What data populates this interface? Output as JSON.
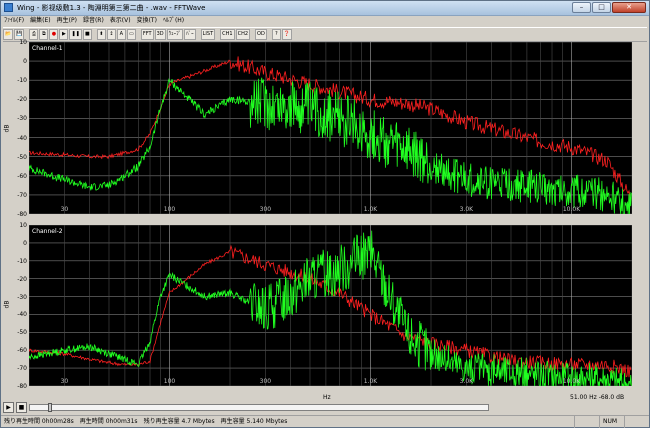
{
  "window": {
    "title": "Wing - 影视级敷1.3 - 陶淵明第三第二曲 - .wav - FFTWave",
    "min_label": "–",
    "max_label": "□",
    "close_label": "✕"
  },
  "menu": [
    "ﾌｧｲﾙ(F)",
    "編集(E)",
    "再生(P)",
    "録音(R)",
    "表示(V)",
    "変換(T)",
    "ﾍﾙﾌﾟ(H)"
  ],
  "toolbar": {
    "buttons": [
      "open",
      "save",
      "",
      "print",
      "copy",
      "rec",
      "play",
      "pause",
      "stop",
      "",
      "cursor",
      "zoom",
      "text",
      "view",
      "",
      "FFT",
      "3D",
      "Wave",
      "Bars",
      "",
      "LIST",
      "",
      "CH1",
      "CH2",
      "",
      "OD",
      "",
      "?",
      "help"
    ],
    "labels": {
      "FFT": "FFT",
      "3D": "3D",
      "Wave": "ｳｪｰﾌﾞ",
      "Bars": "ﾊﾞｰ",
      "LIST": "LIST",
      "CH1": "CH1",
      "CH2": "CH2",
      "OD": "OD",
      "rec": "●",
      "play": "▶",
      "pause": "❚❚",
      "stop": "■",
      "cursor": "⬍",
      "zoom": "↕",
      "text": "A",
      "view": "▭",
      "open": "📂",
      "save": "💾",
      "print": "⎙",
      "copy": "⧉",
      "?": "?",
      "help": "❓"
    }
  },
  "charts": [
    {
      "channel_label": "Channel-1",
      "y_ticks": [
        "10",
        "0",
        "-10",
        "-20",
        "-30",
        "-40",
        "-50",
        "-60",
        "-70",
        "-80"
      ],
      "x_ticks": [
        "30",
        "100",
        "300",
        "1.0K",
        "3.0K",
        "10.0K"
      ],
      "ylabel": "dB"
    },
    {
      "channel_label": "Channel-2",
      "y_ticks": [
        "10",
        "0",
        "-10",
        "-20",
        "-30",
        "-40",
        "-50",
        "-60",
        "-70",
        "-80"
      ],
      "x_ticks": [
        "30",
        "100",
        "300",
        "1.0K",
        "3.0K",
        "10.0K"
      ],
      "ylabel": "dB"
    }
  ],
  "xaxis": {
    "unit_label": "Hz"
  },
  "readout": {
    "freq": "51.00",
    "unit": "Hz",
    "level": "-68.0",
    "level_unit": "dB"
  },
  "chart_data": [
    {
      "type": "line",
      "title": "Channel-1",
      "xlabel": "",
      "ylabel": "dB",
      "xscale": "log",
      "xlim": [
        20,
        20000
      ],
      "ylim": [
        -80,
        10
      ],
      "grid": true,
      "x": [
        20,
        30,
        40,
        50,
        60,
        70,
        80,
        90,
        100,
        150,
        200,
        300,
        500,
        700,
        1000,
        1500,
        2000,
        3000,
        5000,
        7000,
        10000,
        15000,
        20000
      ],
      "series": [
        {
          "color": "#ff2020",
          "values": [
            -48,
            -49,
            -50,
            -50,
            -48,
            -46,
            -38,
            -25,
            -12,
            -5,
            0,
            -6,
            -12,
            -16,
            -20,
            -22,
            -25,
            -32,
            -38,
            -42,
            -45,
            -52,
            -72
          ]
        },
        {
          "color": "#20ff20",
          "values": [
            -56,
            -62,
            -66,
            -65,
            -60,
            -55,
            -45,
            -25,
            -10,
            -28,
            -20,
            -22,
            -25,
            -30,
            -38,
            -48,
            -55,
            -62,
            -65,
            -66,
            -68,
            -70,
            -78
          ]
        }
      ]
    },
    {
      "type": "line",
      "title": "Channel-2",
      "xlabel": "Hz",
      "ylabel": "dB",
      "xscale": "log",
      "xlim": [
        20,
        20000
      ],
      "ylim": [
        -80,
        10
      ],
      "grid": true,
      "x": [
        20,
        30,
        40,
        50,
        60,
        70,
        80,
        90,
        100,
        150,
        200,
        300,
        500,
        700,
        1000,
        1500,
        2000,
        3000,
        5000,
        7000,
        10000,
        15000,
        20000
      ],
      "series": [
        {
          "color": "#ff2020",
          "values": [
            -60,
            -62,
            -65,
            -67,
            -68,
            -68,
            -66,
            -45,
            -28,
            -12,
            -5,
            -12,
            -20,
            -28,
            -40,
            -52,
            -56,
            -60,
            -66,
            -67,
            -68,
            -68,
            -72
          ]
        },
        {
          "color": "#20ff20",
          "values": [
            -64,
            -60,
            -58,
            -62,
            -65,
            -68,
            -55,
            -30,
            -18,
            -30,
            -28,
            -38,
            -20,
            -15,
            -5,
            -50,
            -62,
            -70,
            -72,
            -74,
            -75,
            -76,
            -80
          ]
        }
      ]
    }
  ],
  "transport": {
    "play": "▶",
    "stop": "■",
    "position_fraction": 0.04
  },
  "status": {
    "remaining_time": "残り再生時間 0h00m28s",
    "play_time": "再生時間 0h00m31s",
    "remaining_size": "残り再生容量 4.7 Mbytes",
    "play_size": "再生容量 5.140 Mbytes",
    "num": "NUM"
  }
}
